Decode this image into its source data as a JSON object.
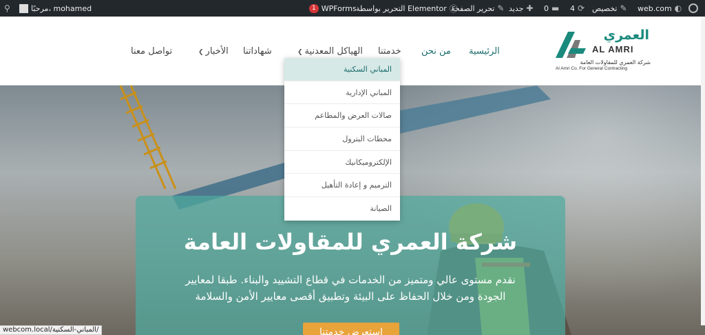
{
  "admin_bar": {
    "site": "web.com",
    "customize": "تخصيص",
    "updates_count": "4",
    "comments_count": "0",
    "new_label": "جديد",
    "edit_page": "تحرير الصفحة",
    "elementor": "التحرير بواسطة Elementor",
    "wpforms": "WPForms",
    "wpforms_badge": "1",
    "greeting": "مرحبًا، mohamed"
  },
  "logo": {
    "ar": "العمري",
    "en": "AL AMRI",
    "sub_ar": "شركة العمري للمقاولات العامة",
    "sub_en": "Al Amri Co. For General Contracting"
  },
  "nav": {
    "home": "الرئيسية",
    "about": "من نحن",
    "services": "خدمتنا",
    "structures": "الهياكل المعدنية",
    "certificates": "شهاداتنا",
    "news": "الأخبار",
    "contact": "تواصل معنا"
  },
  "dropdown": {
    "items": [
      "المباني السكنية",
      "المباني الإدارية",
      "صالات العرض والمطاعم",
      "محطات البترول",
      "الإلكتروميكانيك",
      "الترميم و إعادة التأهيل",
      "الصيانة"
    ]
  },
  "hero": {
    "title": "شركة العمري للمقاولات العامة",
    "desc_line1": "نقدم مستوى عالي ومتميز من الخدمات في قطاع التشييد والبناء. طبقا لمعايير",
    "desc_line2": "الجودة ومن خلال الحفاظ على البيئة وتطبيق أقصى معايير الأمن والسلامة",
    "button": "استعرض خدمتنا"
  },
  "status_bar": {
    "url": "webcom.local/المباني-السكنية/"
  },
  "colors": {
    "accent": "#1a8a7d",
    "admin_bg": "#23282d",
    "button": "#e8a33a"
  }
}
